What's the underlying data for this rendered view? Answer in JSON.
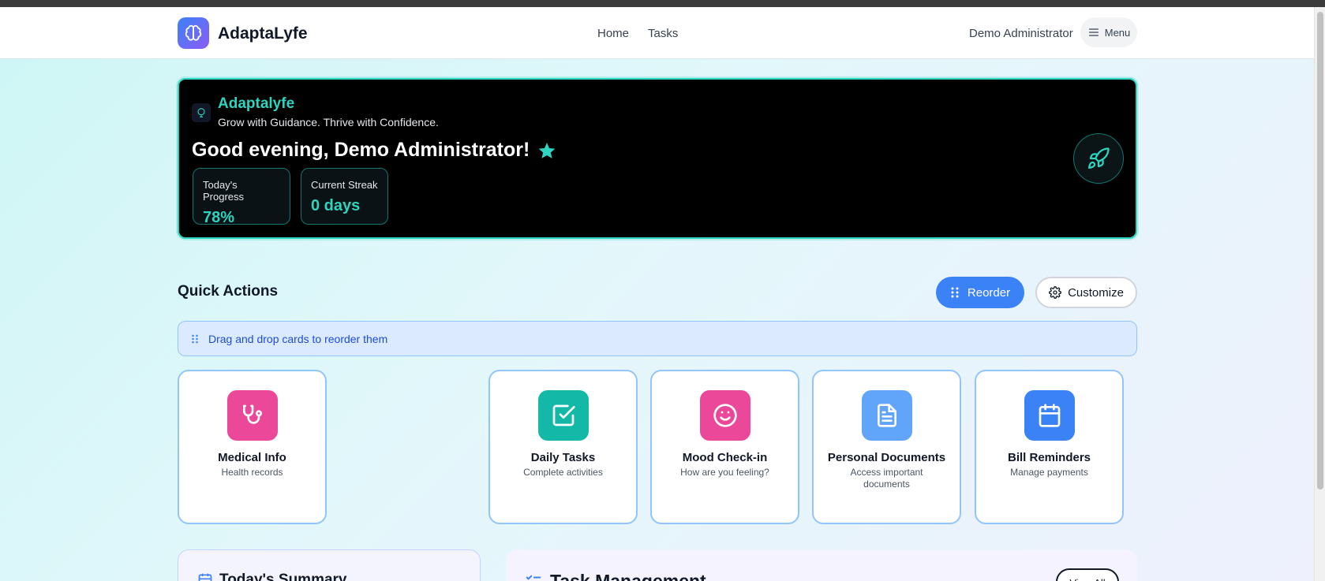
{
  "header": {
    "brand": "AdaptaLyfe",
    "nav": [
      "Home",
      "Tasks"
    ],
    "user": "Demo Administrator",
    "menu_label": "Menu"
  },
  "hero": {
    "brand": "Adaptalyfe",
    "tagline": "Grow with Guidance. Thrive with Confidence.",
    "greeting": "Good evening, Demo Administrator!",
    "stats": [
      {
        "label": "Today's Progress",
        "value": "78%"
      },
      {
        "label": "Current Streak",
        "value": "0 days"
      }
    ]
  },
  "quick_actions": {
    "title": "Quick Actions",
    "reorder_label": "Reorder",
    "customize_label": "Customize",
    "banner": "Drag and drop cards to reorder them",
    "cards": [
      {
        "title": "Medical Info",
        "subtitle": "Health records",
        "icon": "stethoscope-icon",
        "color": "#ec4899"
      },
      {
        "title": "Daily Tasks",
        "subtitle": "Complete activities",
        "icon": "check-square-icon",
        "color": "#14b8a6"
      },
      {
        "title": "Mood Check-in",
        "subtitle": "How are you feeling?",
        "icon": "smile-icon",
        "color": "#ec4899"
      },
      {
        "title": "Personal Documents",
        "subtitle": "Access important documents",
        "icon": "document-icon",
        "color": "#60a5fa"
      },
      {
        "title": "Bill Reminders",
        "subtitle": "Manage payments",
        "icon": "calendar-icon",
        "color": "#3b82f6"
      }
    ]
  },
  "sections": {
    "summary_title": "Today's Summary",
    "tasks_title": "Task Management",
    "view_all": "View All"
  },
  "colors": {
    "accent": "#2dd4bf",
    "primary": "#3b82f6"
  }
}
